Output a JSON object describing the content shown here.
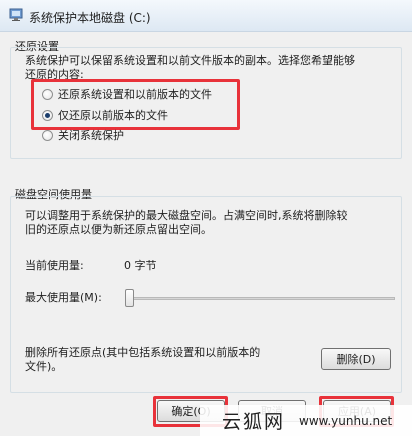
{
  "window": {
    "title": "系统保护本地磁盘 (C:)"
  },
  "restore_settings": {
    "heading": "还原设置",
    "description_line1": "系统保护可以保留系统设置和以前文件版本的副本。选择您希望能够",
    "description_line2": "还原的内容:",
    "options": [
      {
        "label": "还原系统设置和以前版本的文件",
        "selected": false
      },
      {
        "label": "仅还原以前版本的文件",
        "selected": true
      },
      {
        "label": "关闭系统保护",
        "selected": false
      }
    ]
  },
  "disk_space": {
    "heading": "磁盘空间使用量",
    "description_line1": "可以调整用于系统保护的最大磁盘空间。占满空间时,系统将删除较",
    "description_line2": "旧的还原点以便为新还原点留出空间。",
    "current_usage_label": "当前使用量:",
    "current_usage_value": "0 字节",
    "max_usage_label": "最大使用量(M):",
    "max_usage_level": 0
  },
  "delete": {
    "description_line1": "删除所有还原点(其中包括系统设置和以前版本的",
    "description_line2": "文件)。",
    "button_label": "删除(D)"
  },
  "footer": {
    "ok_label": "确定(O)",
    "cancel_label": "取消",
    "apply_label": "应用(A)"
  },
  "watermark": {
    "brand": "云狐网",
    "url": "www.yunhu.net"
  },
  "colors": {
    "highlight": "#e8323a",
    "titlebar": "#dde8f3"
  }
}
